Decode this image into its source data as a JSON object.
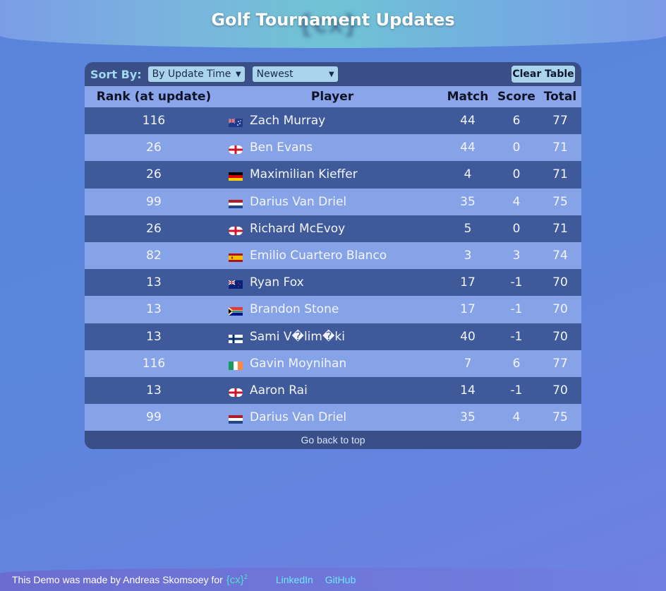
{
  "header": {
    "title": "Golf Tournament Updates",
    "logo_text": "{cx}"
  },
  "controls": {
    "sort_label": "Sort By:",
    "sort_field": "By Update Time",
    "sort_order": "Newest",
    "clear_label": "Clear Table"
  },
  "table": {
    "columns": [
      "Rank (at update)",
      "Player",
      "Match",
      "Score",
      "Total"
    ],
    "rows": [
      {
        "rank": "116",
        "flag": "australia-flag",
        "player": "Zach Murray",
        "match": "44",
        "score": "6",
        "total": "77"
      },
      {
        "rank": "26",
        "flag": "england-flag",
        "player": "Ben Evans",
        "match": "44",
        "score": "0",
        "total": "71"
      },
      {
        "rank": "26",
        "flag": "germany-flag",
        "player": "Maximilian Kieffer",
        "match": "4",
        "score": "0",
        "total": "71"
      },
      {
        "rank": "99",
        "flag": "netherlands-flag",
        "player": "Darius Van Driel",
        "match": "35",
        "score": "4",
        "total": "75"
      },
      {
        "rank": "26",
        "flag": "england-flag",
        "player": "Richard McEvoy",
        "match": "5",
        "score": "0",
        "total": "71"
      },
      {
        "rank": "82",
        "flag": "spain-flag",
        "player": "Emilio Cuartero Blanco",
        "match": "3",
        "score": "3",
        "total": "74"
      },
      {
        "rank": "13",
        "flag": "new-zealand-flag",
        "player": "Ryan Fox",
        "match": "17",
        "score": "-1",
        "total": "70"
      },
      {
        "rank": "13",
        "flag": "south-africa-flag",
        "player": "Brandon Stone",
        "match": "17",
        "score": "-1",
        "total": "70"
      },
      {
        "rank": "13",
        "flag": "finland-flag",
        "player": "Sami V�lim�ki",
        "match": "40",
        "score": "-1",
        "total": "70"
      },
      {
        "rank": "116",
        "flag": "ireland-flag",
        "player": "Gavin Moynihan",
        "match": "7",
        "score": "6",
        "total": "77"
      },
      {
        "rank": "13",
        "flag": "england-flag",
        "player": "Aaron Rai",
        "match": "14",
        "score": "-1",
        "total": "70"
      },
      {
        "rank": "99",
        "flag": "netherlands-flag",
        "player": "Darius Van Driel",
        "match": "35",
        "score": "4",
        "total": "75"
      }
    ],
    "footer_label": "Go back to top"
  },
  "footer": {
    "credit_text": "This Demo was made by Andreas Skomsoey for",
    "cx_text": "{cx}",
    "cx_sup": "2",
    "linkedin_label": "LinkedIn",
    "github_label": "GitHub"
  },
  "colors": {
    "row_dark": "#3f5a9a",
    "row_light": "#87a3e8",
    "header_row": "#8aa5ea",
    "accent": "#a9d4ec"
  }
}
